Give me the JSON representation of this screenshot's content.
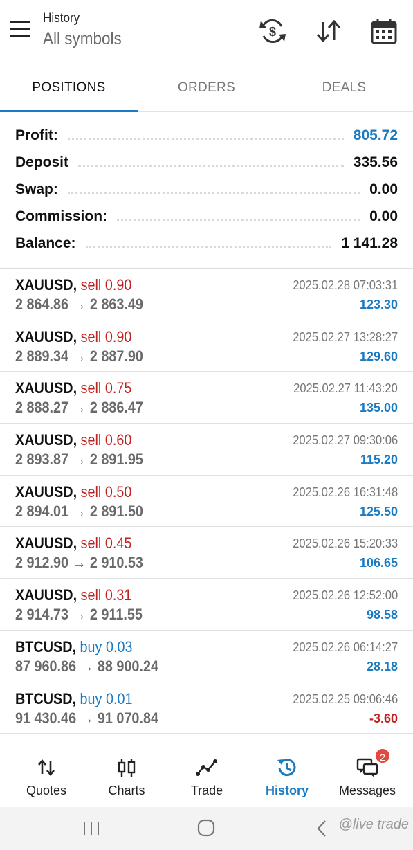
{
  "header": {
    "title": "History",
    "subtitle": "All symbols",
    "icons": [
      "menu-icon",
      "currency-exchange-icon",
      "sort-icon",
      "calendar-icon"
    ]
  },
  "tabs": [
    {
      "label": "POSITIONS",
      "active": true
    },
    {
      "label": "ORDERS",
      "active": false
    },
    {
      "label": "DEALS",
      "active": false
    }
  ],
  "summary": [
    {
      "label": "Profit:",
      "value": "805.72"
    },
    {
      "label": "Deposit",
      "value": "335.56"
    },
    {
      "label": "Swap:",
      "value": "0.00"
    },
    {
      "label": "Commission:",
      "value": "0.00"
    },
    {
      "label": "Balance:",
      "value": "1 141.28"
    }
  ],
  "deals": [
    {
      "symbol": "XAUUSD,",
      "side": "sell",
      "volume": "sell 0.90",
      "prices": "2 864.86 → 2 863.49",
      "time": "2025.02.28 07:03:31",
      "profit": "123.30"
    },
    {
      "symbol": "XAUUSD,",
      "side": "sell",
      "volume": "sell 0.90",
      "prices": "2 889.34 → 2 887.90",
      "time": "2025.02.27 13:28:27",
      "profit": "129.60"
    },
    {
      "symbol": "XAUUSD,",
      "side": "sell",
      "volume": "sell 0.75",
      "prices": "2 888.27 → 2 886.47",
      "time": "2025.02.27 11:43:20",
      "profit": "135.00"
    },
    {
      "symbol": "XAUUSD,",
      "side": "sell",
      "volume": "sell 0.60",
      "prices": "2 893.87 → 2 891.95",
      "time": "2025.02.27 09:30:06",
      "profit": "115.20"
    },
    {
      "symbol": "XAUUSD,",
      "side": "sell",
      "volume": "sell 0.50",
      "prices": "2 894.01 → 2 891.50",
      "time": "2025.02.26 16:31:48",
      "profit": "125.50"
    },
    {
      "symbol": "XAUUSD,",
      "side": "sell",
      "volume": "sell 0.45",
      "prices": "2 912.90 → 2 910.53",
      "time": "2025.02.26 15:20:33",
      "profit": "106.65"
    },
    {
      "symbol": "XAUUSD,",
      "side": "sell",
      "volume": "sell 0.31",
      "prices": "2 914.73 → 2 911.55",
      "time": "2025.02.26 12:52:00",
      "profit": "98.58"
    },
    {
      "symbol": "BTCUSD,",
      "side": "buy",
      "volume": "buy 0.03",
      "prices": "87 960.86 → 88 900.24",
      "time": "2025.02.26 06:14:27",
      "profit": "28.18"
    },
    {
      "symbol": "BTCUSD,",
      "side": "buy",
      "volume": "buy 0.01",
      "prices": "91 430.46 → 91 070.84",
      "time": "2025.02.25 09:06:46",
      "profit": "-3.60"
    }
  ],
  "nav": [
    {
      "label": "Quotes",
      "icon": "quotes-icon",
      "active": false
    },
    {
      "label": "Charts",
      "icon": "candlestick-icon",
      "active": false
    },
    {
      "label": "Trade",
      "icon": "trade-icon",
      "active": false
    },
    {
      "label": "History",
      "icon": "history-icon",
      "active": true
    },
    {
      "label": "Messages",
      "icon": "messages-icon",
      "active": false,
      "badge": "2"
    }
  ],
  "system_bar": {
    "watermark": "@live trade"
  },
  "colors": {
    "accent": "#1a7ac2",
    "sell": "#c0201e",
    "badge": "#e04a3f"
  }
}
